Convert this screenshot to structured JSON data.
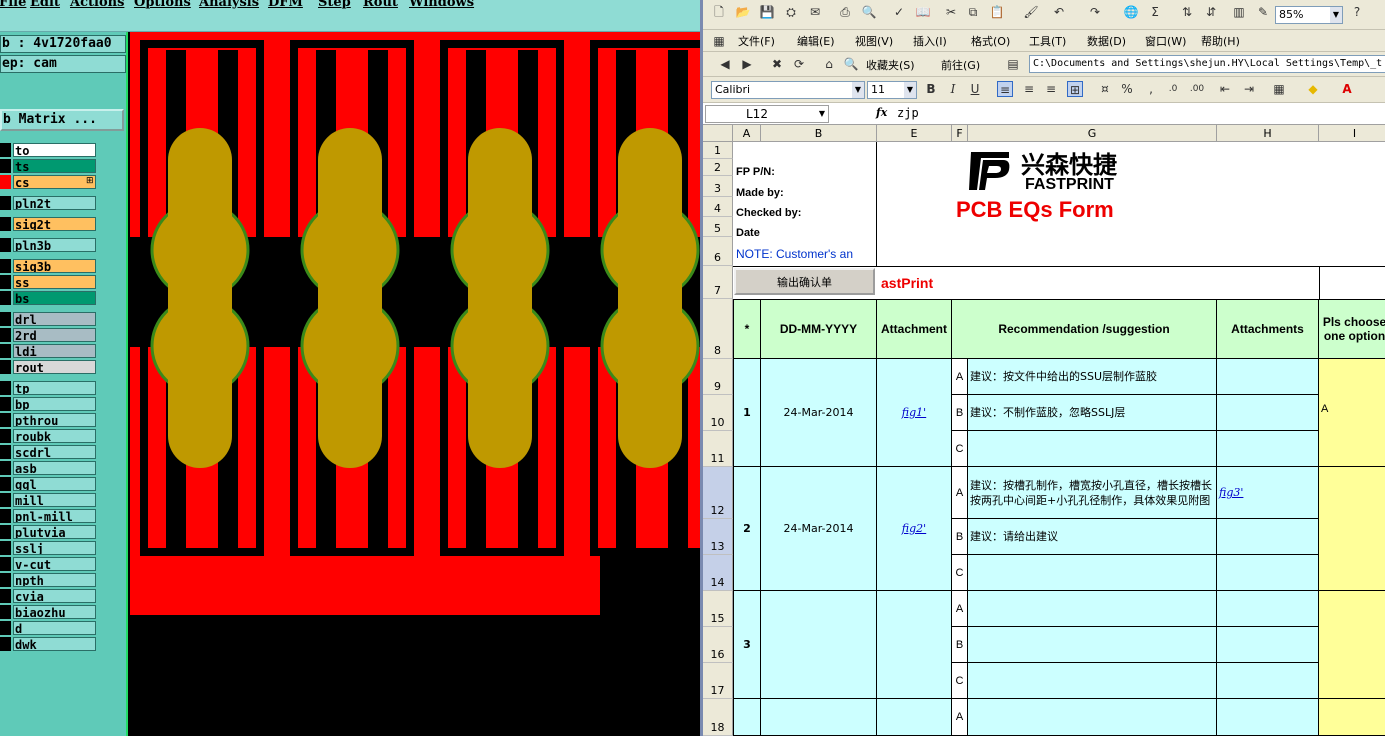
{
  "cam": {
    "menu": [
      "File",
      "Edit",
      "Actions",
      "Options",
      "Analysis",
      "DFM",
      "Step",
      "Rout",
      "Windows"
    ],
    "job_label": "b : 4v1720faa0",
    "step_label": "ep: cam",
    "matrix_button": "b Matrix ...",
    "layers": [
      {
        "name": "to",
        "swatch": "#000000",
        "bg": "#ffffff"
      },
      {
        "name": "ts",
        "swatch": "#000000",
        "bg": "#009970"
      },
      {
        "name": "cs",
        "swatch": "#ff0000",
        "bg": "#ffc060",
        "marker": "⊞"
      },
      {
        "name": "pln2t",
        "swatch": "#000000",
        "bg": "#8fdcd4"
      },
      {
        "name": "sig2t",
        "swatch": "#000000",
        "bg": "#ffc060"
      },
      {
        "name": "pln3b",
        "swatch": "#000000",
        "bg": "#8fdcd4"
      },
      {
        "name": "sig3b",
        "swatch": "#000000",
        "bg": "#ffc060"
      },
      {
        "name": "ss",
        "swatch": "#000000",
        "bg": "#ffc060"
      },
      {
        "name": "bs",
        "swatch": "#000000",
        "bg": "#009970"
      },
      {
        "name": "drl",
        "swatch": "#000000",
        "bg": "#a8bcc4"
      },
      {
        "name": "2rd",
        "swatch": "#000000",
        "bg": "#a8bcc4"
      },
      {
        "name": "ldi",
        "swatch": "#000000",
        "bg": "#a8bcc4"
      },
      {
        "name": "rout",
        "swatch": "#000000",
        "bg": "#d8d8d8"
      },
      {
        "name": "tp",
        "swatch": "#000000",
        "bg": "#8fdcd4"
      },
      {
        "name": "bp",
        "swatch": "#000000",
        "bg": "#8fdcd4"
      },
      {
        "name": "pthrou",
        "swatch": "#000000",
        "bg": "#8fdcd4"
      },
      {
        "name": "roubk",
        "swatch": "#000000",
        "bg": "#8fdcd4"
      },
      {
        "name": "scdrl",
        "swatch": "#000000",
        "bg": "#8fdcd4"
      },
      {
        "name": "asb",
        "swatch": "#000000",
        "bg": "#8fdcd4"
      },
      {
        "name": "ggl",
        "swatch": "#000000",
        "bg": "#8fdcd4"
      },
      {
        "name": "mill",
        "swatch": "#000000",
        "bg": "#8fdcd4"
      },
      {
        "name": "pnl-mill",
        "swatch": "#000000",
        "bg": "#8fdcd4"
      },
      {
        "name": "plutvia",
        "swatch": "#000000",
        "bg": "#8fdcd4"
      },
      {
        "name": "sslj",
        "swatch": "#000000",
        "bg": "#8fdcd4"
      },
      {
        "name": "v-cut",
        "swatch": "#000000",
        "bg": "#8fdcd4"
      },
      {
        "name": "npth",
        "swatch": "#000000",
        "bg": "#8fdcd4"
      },
      {
        "name": "cvia",
        "swatch": "#000000",
        "bg": "#8fdcd4"
      },
      {
        "name": "biaozhu",
        "swatch": "#000000",
        "bg": "#8fdcd4"
      },
      {
        "name": "d",
        "swatch": "#000000",
        "bg": "#8fdcd4"
      },
      {
        "name": "dwk",
        "swatch": "#000000",
        "bg": "#8fdcd4"
      }
    ],
    "colors": {
      "copper": "#ff0000",
      "pad": "#bf9900",
      "pad_ring": "#3a8a1a",
      "background": "#000000"
    }
  },
  "excel": {
    "menu": [
      "文件(F)",
      "编辑(E)",
      "视图(V)",
      "插入(I)",
      "格式(O)",
      "工具(T)",
      "数据(D)",
      "窗口(W)",
      "帮助(H)"
    ],
    "favorites_label": "收藏夹(S)",
    "goto_label": "前往(G)",
    "address_path": "C:\\Documents and Settings\\shejun.HY\\Local Settings\\Temp\\_t",
    "zoom": "85%",
    "font_name": "Calibri",
    "font_size": "11",
    "name_box": "L12",
    "fx": "fx",
    "formula_value": "zjp",
    "columns": [
      "A",
      "B",
      "E",
      "F",
      "G",
      "H",
      "I"
    ],
    "rows": [
      "1",
      "2",
      "3",
      "4",
      "5",
      "6",
      "7",
      "8",
      "9",
      "10",
      "11",
      "12",
      "13",
      "14",
      "15",
      "16",
      "17",
      "18"
    ],
    "labels": {
      "fp_pn": "FP P/N:",
      "made_by": "Made by:",
      "checked_by": "Checked by:",
      "date": "Date",
      "note": "NOTE: Customer's  an"
    },
    "logo_cn": "兴森快捷",
    "logo_en": "FASTPRINT",
    "form_title": "PCB EQs Form",
    "output_button": "输出确认单",
    "row7_text": "astPrint",
    "headers": {
      "star": "*",
      "date": "DD-MM-YYYY",
      "attachment": "Attachment",
      "recommendation": "Recommendation /suggestion",
      "attachments": "Attachments",
      "choose": "Pls choose one option"
    },
    "items": [
      {
        "no": "1",
        "date": "24-Mar-2014",
        "fig": "fig1'",
        "options": [
          {
            "letter": "A",
            "text": "建议：按文件中给出的SSU层制作蓝胶",
            "att": ""
          },
          {
            "letter": "B",
            "text": "建议：不制作蓝胶，忽略SSLJ层",
            "att": ""
          },
          {
            "letter": "C",
            "text": "",
            "att": ""
          }
        ],
        "choice": "A"
      },
      {
        "no": "2",
        "date": "24-Mar-2014",
        "fig": "fig2'",
        "options": [
          {
            "letter": "A",
            "text": "建议：按槽孔制作，槽宽按小孔直径，槽长按槽长按两孔中心间距+小孔孔径制作，具体效果见附图",
            "att": "fig3'"
          },
          {
            "letter": "B",
            "text": "建议：请给出建议",
            "att": ""
          },
          {
            "letter": "C",
            "text": "",
            "att": ""
          }
        ],
        "choice": ""
      },
      {
        "no": "3",
        "date": "",
        "fig": "",
        "options": [
          {
            "letter": "A",
            "text": "",
            "att": ""
          },
          {
            "letter": "B",
            "text": "",
            "att": ""
          },
          {
            "letter": "C",
            "text": "",
            "att": ""
          }
        ],
        "choice": ""
      },
      {
        "no": "",
        "date": "",
        "fig": "",
        "options": [
          {
            "letter": "A",
            "text": "",
            "att": ""
          }
        ],
        "choice": ""
      }
    ]
  }
}
